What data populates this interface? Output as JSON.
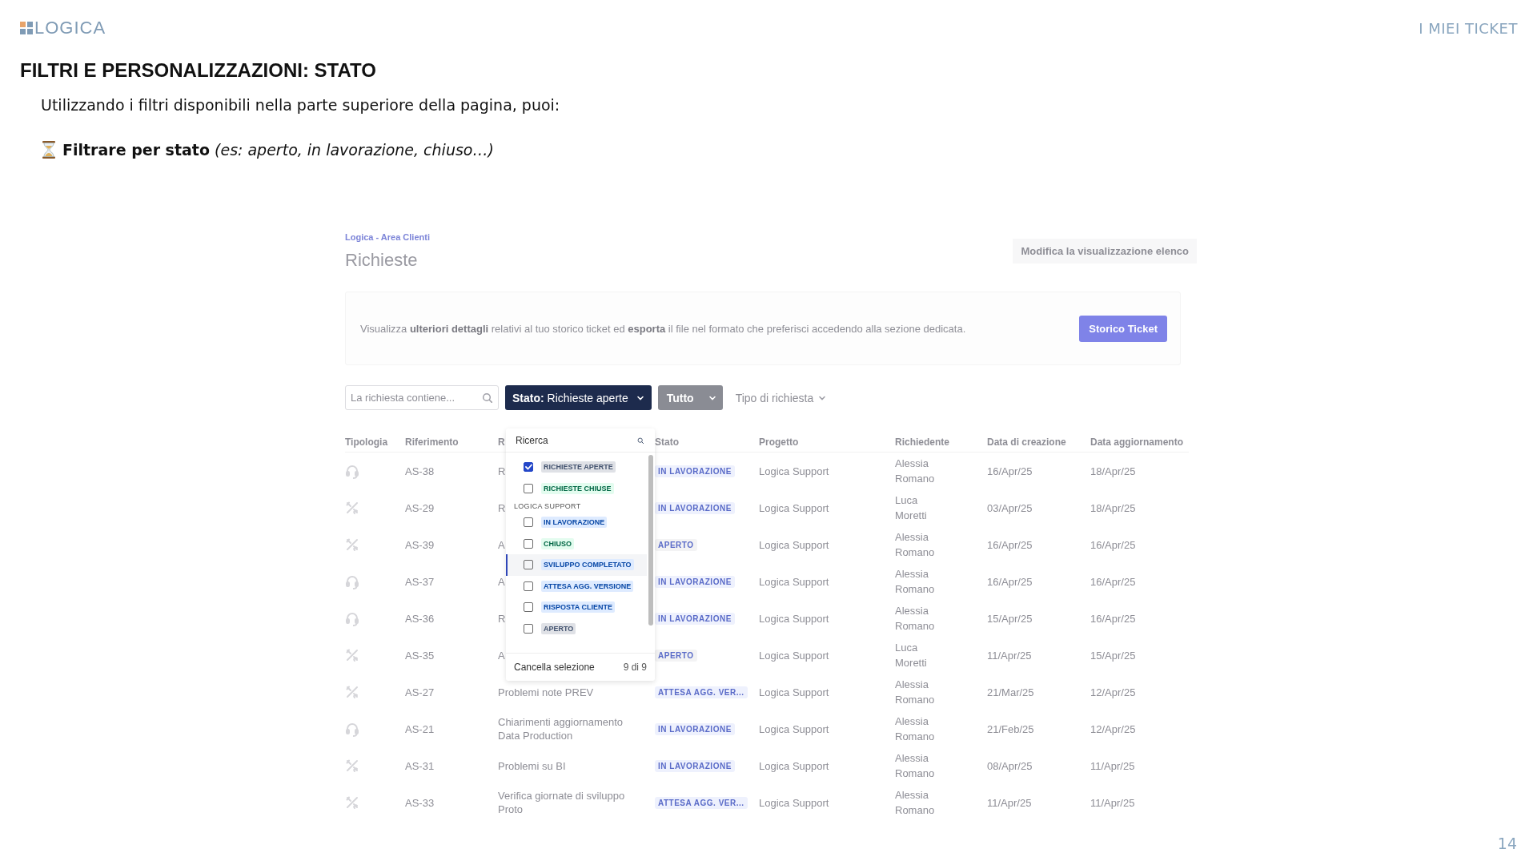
{
  "slide": {
    "logo": "LOGICA",
    "section": "I MIEI TICKET",
    "title": "FILTRI E PERSONALIZZAZIONI: STATO",
    "intro": "Utilizzando i filtri disponibili nella parte superiore della pagina, puoi:",
    "bullet": "**Filtrare per stato** *(es: aperto, in lavorazione, chiuso…)*",
    "page_number": "14"
  },
  "app": {
    "breadcrumb": "Logica - Area Clienti",
    "title": "Richieste",
    "view_button": "Modifica la visualizzazione elenco",
    "banner": {
      "text": "Visualizza **ulteriori dettagli** relativi al tuo storico ticket ed **esporta** il file nel formato che preferisci accedendo alla sezione dedicata.",
      "button": "Storico Ticket"
    },
    "filters": {
      "search_placeholder": "La richiesta contiene...",
      "status_button": "**Stato:** Richieste aperte",
      "all_button": "Tutto",
      "type_button": "Tipo di richiesta"
    },
    "table": {
      "columns": [
        "Tipologia",
        "Riferimento",
        "R",
        "Stato",
        "Progetto",
        "Richiedente",
        "Data di creazione",
        "Data aggiornamento"
      ],
      "rows": [
        {
          "kind": "support",
          "ref": "AS-38",
          "summary": "R",
          "status": {
            "label": "IN LAVORAZIONE",
            "color": "#eef1fd"
          },
          "project": "Logica Support",
          "requester": "Alessia Romano",
          "created": "16/Apr/25",
          "updated": "18/Apr/25"
        },
        {
          "kind": "change",
          "ref": "AS-29",
          "summary": "R",
          "status": {
            "label": "IN LAVORAZIONE",
            "color": "#eef1fd"
          },
          "project": "Logica Support",
          "requester": "Luca Moretti",
          "created": "03/Apr/25",
          "updated": "18/Apr/25"
        },
        {
          "kind": "change",
          "ref": "AS-39",
          "summary": "A",
          "status": {
            "label": "APERTO",
            "color": "#f3f3f4"
          },
          "project": "Logica Support",
          "requester": "Alessia Romano",
          "created": "16/Apr/25",
          "updated": "16/Apr/25"
        },
        {
          "kind": "support",
          "ref": "AS-37",
          "summary": "A",
          "status": {
            "label": "IN LAVORAZIONE",
            "color": "#eef1fd"
          },
          "project": "Logica Support",
          "requester": "Alessia Romano",
          "created": "16/Apr/25",
          "updated": "16/Apr/25"
        },
        {
          "kind": "support",
          "ref": "AS-36",
          "summary": "R",
          "status": {
            "label": "IN LAVORAZIONE",
            "color": "#eef1fd"
          },
          "project": "Logica Support",
          "requester": "Alessia Romano",
          "created": "15/Apr/25",
          "updated": "16/Apr/25"
        },
        {
          "kind": "change",
          "ref": "AS-35",
          "summary": "A",
          "status": {
            "label": "APERTO",
            "color": "#f3f3f4"
          },
          "project": "Logica Support",
          "requester": "Luca Moretti",
          "created": "11/Apr/25",
          "updated": "15/Apr/25"
        },
        {
          "kind": "change",
          "ref": "AS-27",
          "summary": "Problemi note PREV",
          "status": {
            "label": "ATTESA AGG. VER...",
            "color": "#eef1fd"
          },
          "project": "Logica Support",
          "requester": "Alessia Romano",
          "created": "21/Mar/25",
          "updated": "12/Apr/25"
        },
        {
          "kind": "support",
          "ref": "AS-21",
          "summary": "Chiarimenti aggiornamento Data Production",
          "status": {
            "label": "IN LAVORAZIONE",
            "color": "#eef1fd"
          },
          "project": "Logica Support",
          "requester": "Alessia Romano",
          "created": "21/Feb/25",
          "updated": "12/Apr/25"
        },
        {
          "kind": "change",
          "ref": "AS-31",
          "summary": "Problemi su BI",
          "status": {
            "label": "IN LAVORAZIONE",
            "color": "#eef1fd"
          },
          "project": "Logica Support",
          "requester": "Alessia Romano",
          "created": "08/Apr/25",
          "updated": "11/Apr/25"
        },
        {
          "kind": "change",
          "ref": "AS-33",
          "summary": "Verifica giornate di sviluppo Proto",
          "status": {
            "label": "ATTESA AGG. VER...",
            "color": "#eef1fd"
          },
          "project": "Logica Support",
          "requester": "Alessia Romano",
          "created": "11/Apr/25",
          "updated": "11/Apr/25"
        }
      ]
    },
    "dropdown": {
      "search_placeholder": "Ricerca",
      "options": [
        {
          "kind": "option",
          "label": "RICHIESTE APERTE",
          "color": "#dfe1e6",
          "checked": true,
          "focused": false
        },
        {
          "kind": "option",
          "label": "RICHIESTE CHIUSE",
          "color": "#e3fcef",
          "checked": false,
          "focused": false
        },
        {
          "kind": "group",
          "label": "LOGICA SUPPORT"
        },
        {
          "kind": "option",
          "label": "IN LAVORAZIONE",
          "color": "#deebff",
          "checked": false,
          "focused": false
        },
        {
          "kind": "option",
          "label": "CHIUSO",
          "color": "#e3fcef",
          "checked": false,
          "focused": false
        },
        {
          "kind": "option",
          "label": "SVILUPPO COMPLETATO",
          "color": "#deebff",
          "checked": false,
          "focused": true
        },
        {
          "kind": "option",
          "label": "ATTESA AGG. VERSIONE",
          "color": "#deebff",
          "checked": false,
          "focused": false
        },
        {
          "kind": "option",
          "label": "RISPOSTA CLIENTE",
          "color": "#deebff",
          "checked": false,
          "focused": false
        },
        {
          "kind": "option",
          "label": "APERTO",
          "color": "#dfe1e6",
          "checked": false,
          "focused": false
        }
      ],
      "clear_button": "Cancella selezione",
      "count": "9 di 9"
    }
  }
}
